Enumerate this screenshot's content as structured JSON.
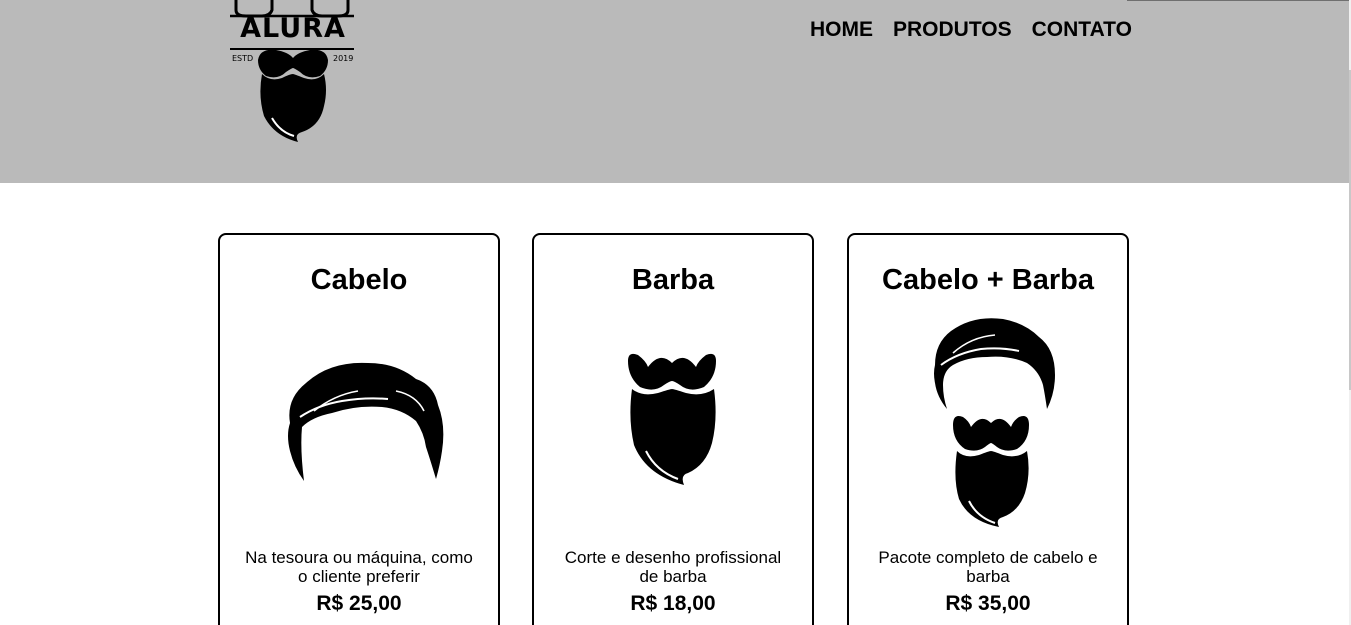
{
  "logo": {
    "brand": "ALURA",
    "estd": "ESTD",
    "year": "2019"
  },
  "nav": {
    "items": [
      "HOME",
      "PRODUTOS",
      "CONTATO"
    ]
  },
  "products": [
    {
      "title": "Cabelo",
      "description": "Na tesoura ou máquina, como o cliente preferir",
      "price": "R$ 25,00",
      "icon": "hair-icon"
    },
    {
      "title": "Barba",
      "description": "Corte e desenho profissional de barba",
      "price": "R$ 18,00",
      "icon": "beard-icon"
    },
    {
      "title": "Cabelo + Barba",
      "description": "Pacote completo de cabelo e barba",
      "price": "R$ 35,00",
      "icon": "hair-and-beard-icon"
    }
  ],
  "colors": {
    "header_bg": "#bababa",
    "text": "#000000",
    "card_border": "#000000"
  }
}
